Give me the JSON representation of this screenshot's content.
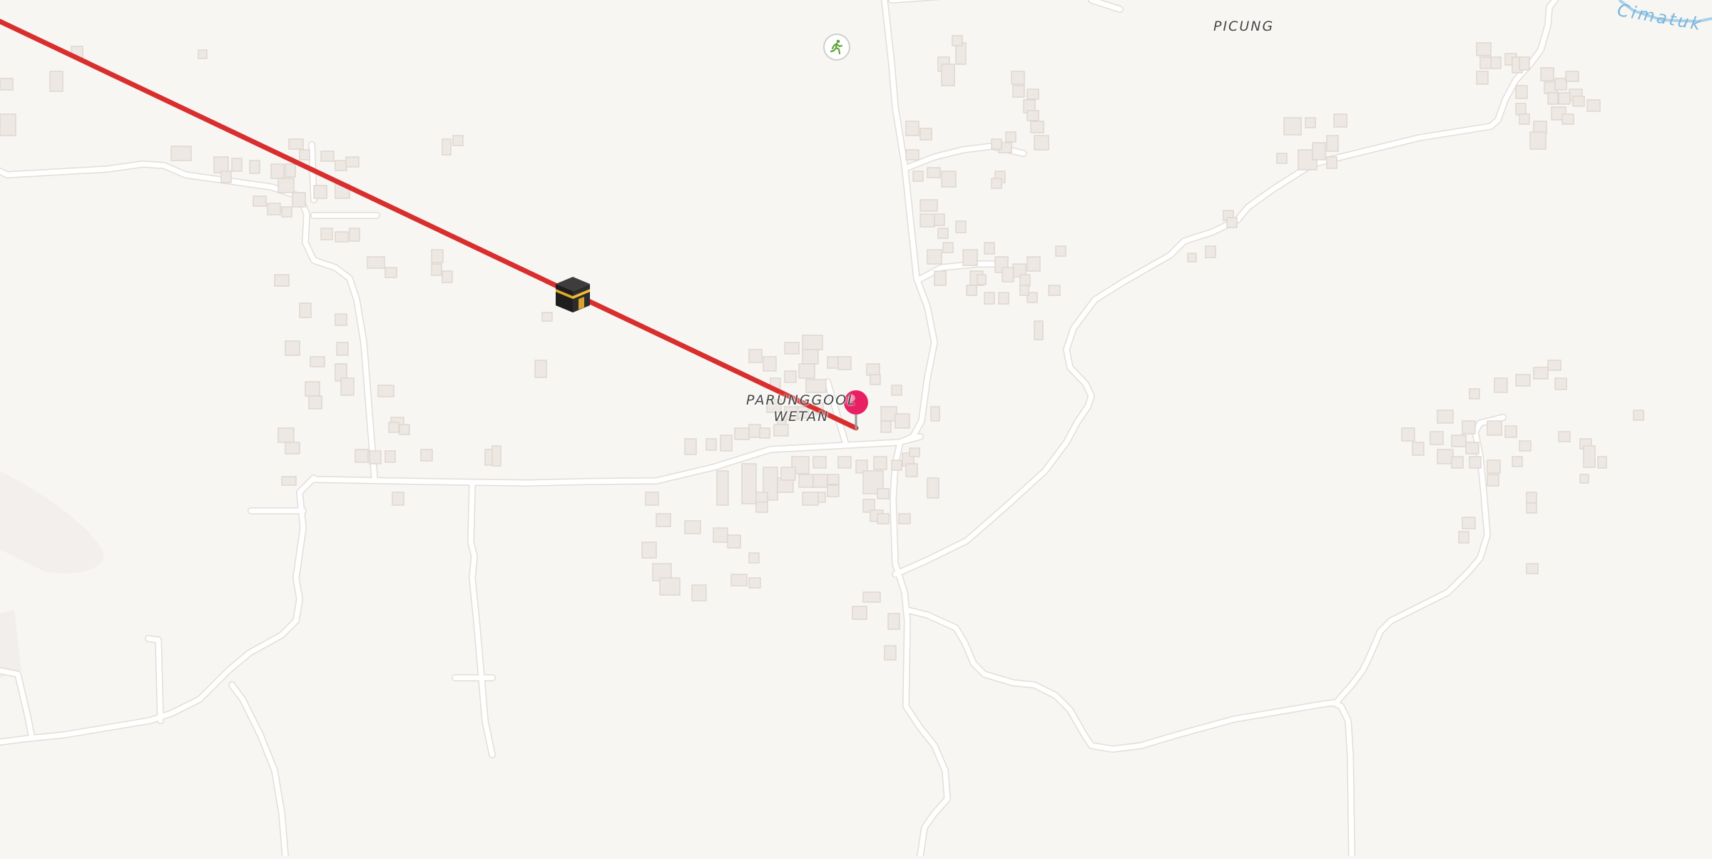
{
  "map": {
    "place_labels": [
      {
        "id": "picung",
        "text": "PICUNG"
      },
      {
        "id": "parunggool-line1",
        "text": "PARUNGGOOL"
      },
      {
        "id": "parunggool-line2",
        "text": "WETAN"
      }
    ],
    "water_label": {
      "text": "Cimatuk"
    },
    "qibla_line": {
      "color": "#d82e2e",
      "description": "direction line toward Kaaba"
    },
    "markers": {
      "location_pin_color": "#e81f62",
      "kaaba_icon": "kaaba-icon",
      "poi_icon": "running-person-icon",
      "poi_icon_color": "#5ea33a"
    },
    "colors": {
      "background": "#f8f6f3",
      "road": "#ffffff",
      "road_casing": "#e4e0db",
      "building": "#ede8e3",
      "building_outline": "#ded7d0"
    }
  }
}
